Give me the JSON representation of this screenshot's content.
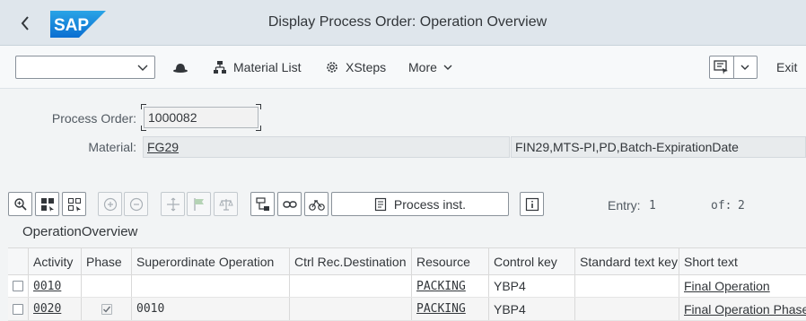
{
  "shell": {
    "title": "Display Process Order: Operation Overview",
    "logo_text": "SAP",
    "brand_color": "#0a6ed1"
  },
  "toolbar": {
    "select_value": "",
    "hat_icon": "hat-icon",
    "material_list": "Material List",
    "xsteps": "XSteps",
    "more": "More",
    "exit": "Exit"
  },
  "form": {
    "process_order_label": "Process Order:",
    "process_order_value": "1000082",
    "material_label": "Material:",
    "material_value": "FG29",
    "material_desc": "FIN29,MTS-PI,PD,Batch-ExpirationDate"
  },
  "table_toolbar": {
    "process_inst_label": "Process inst.",
    "entry_label": "Entry:",
    "entry_value": "1",
    "of_label": "of:",
    "of_value": "2"
  },
  "section_title": "OperationOverview",
  "table": {
    "columns": [
      "Activity",
      "Phase",
      "Superordinate Operation",
      "Ctrl Rec.Destination",
      "Resource",
      "Control key",
      "Standard text key",
      "Short text"
    ],
    "rows": [
      {
        "activity": "0010",
        "phase_checked": false,
        "superordinate": "",
        "ctrl_rec": "",
        "resource": "PACKING",
        "control_key": "YBP4",
        "std_text_key": "",
        "short_text": "Final Operation"
      },
      {
        "activity": "0020",
        "phase_checked": true,
        "superordinate": "0010",
        "ctrl_rec": "",
        "resource": "PACKING",
        "control_key": "YBP4",
        "std_text_key": "",
        "short_text": "Final Operation Phase"
      }
    ]
  }
}
